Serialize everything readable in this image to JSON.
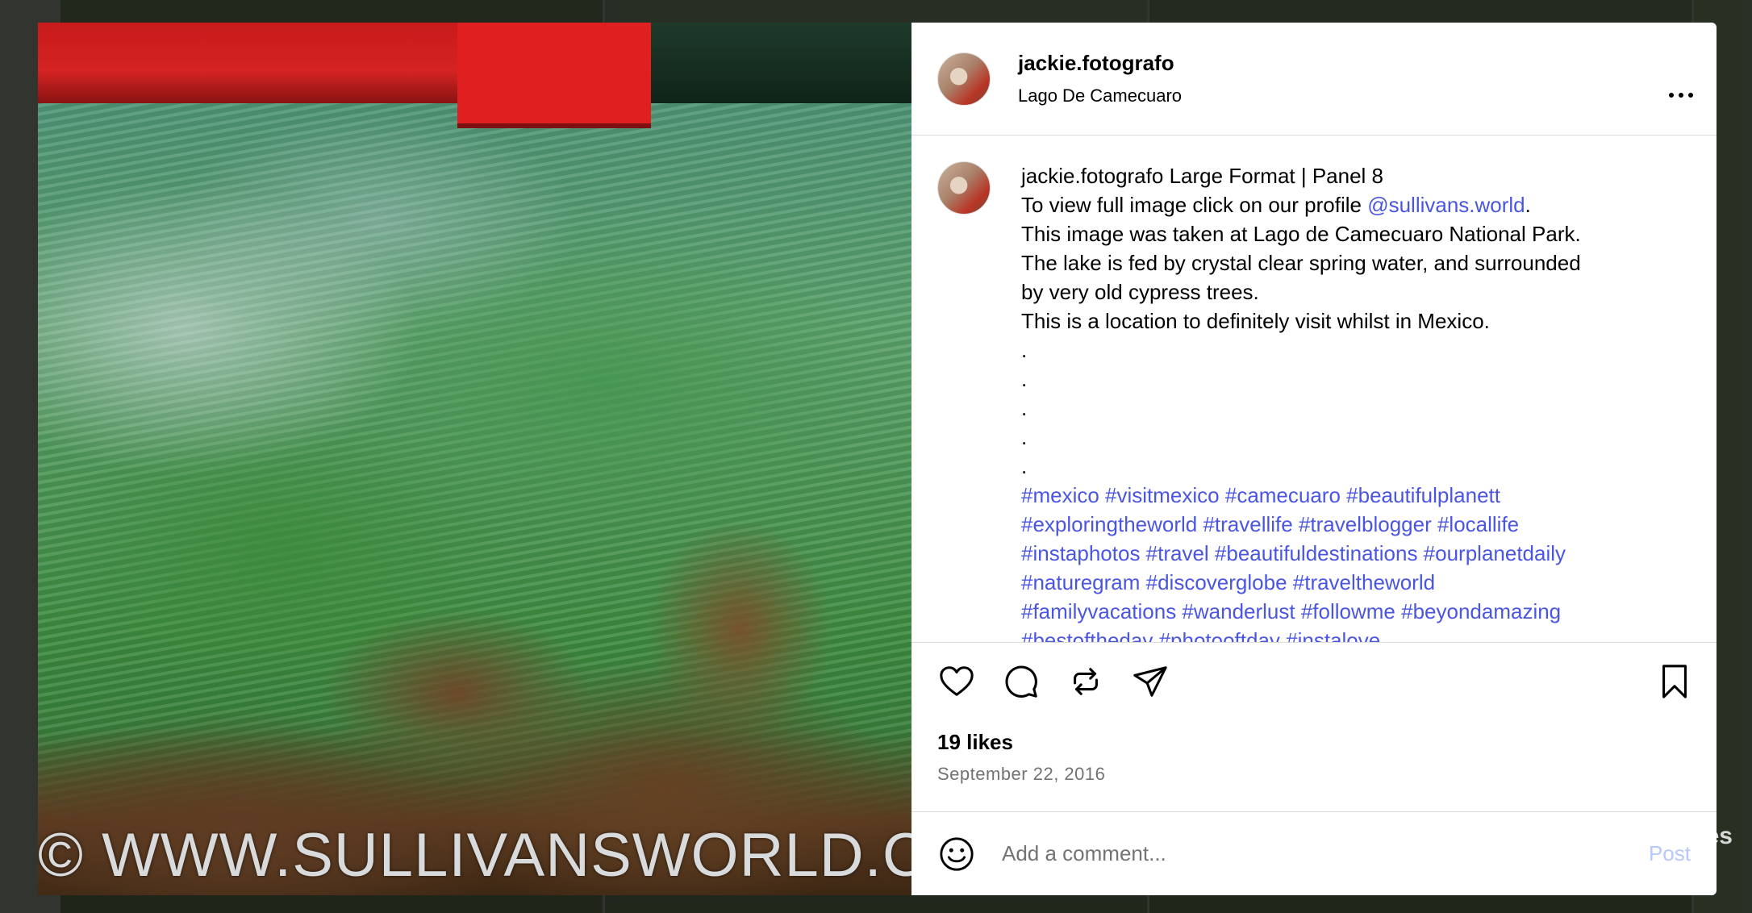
{
  "background": {
    "peek_text": "es"
  },
  "media": {
    "watermark": "© WWW.SULLIVANSWORLD.CO"
  },
  "post": {
    "username": "jackie.fotografo",
    "location": "Lago De Camecuaro",
    "more_icon": "more-horizontal-icon",
    "caption": {
      "username": "jackie.fotografo",
      "title": "Large Format | Panel 8",
      "line2_prefix": "To view full image click on our profile ",
      "line2_mention": "@sullivans.world",
      "line2_suffix": ".",
      "line3": "This image was taken at Lago de Camecuaro National Park.",
      "line4": "The lake is fed by crystal clear spring water, and surrounded",
      "line5": "by very old cypress trees.",
      "line6": "This is a location to definitely visit whilst in Mexico.",
      "dots": [
        ".",
        ".",
        ".",
        ".",
        "."
      ],
      "hashtag_lines": [
        "#mexico #visitmexico #camecuaro #beautifulplanett",
        "#exploringtheworld #travellife #travelblogger #locallife",
        "#instaphotos #travel #beautifuldestinations #ourplanetdaily",
        "#naturegram #discoverglobe #traveltheworld",
        "#familyvacations #wanderlust #followme #beyondamazing",
        "#bestoftheday #photooftday #instalove"
      ]
    },
    "actions": {
      "icons": [
        "heart-icon",
        "comment-icon",
        "repost-icon",
        "share-icon",
        "bookmark-icon"
      ]
    },
    "likes": "19 likes",
    "date": "September 22, 2016",
    "comment": {
      "placeholder": "Add a comment...",
      "post_label": "Post"
    }
  },
  "colors": {
    "link": "#4a56e0",
    "post_button_disabled": "#b6c8ff",
    "muted_text": "#737373",
    "divider": "#dbdbdb"
  }
}
